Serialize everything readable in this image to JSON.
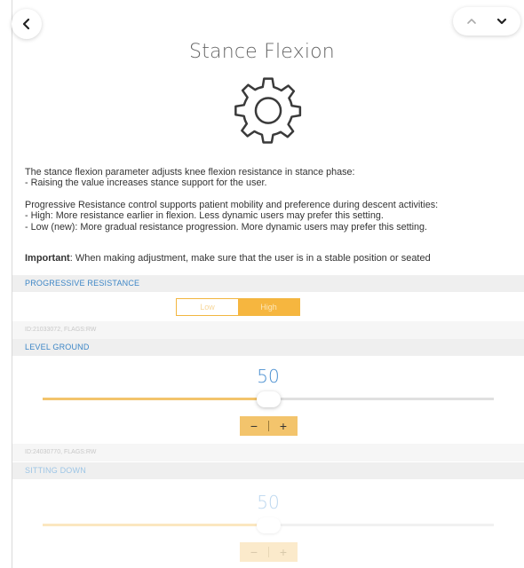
{
  "header": {
    "title": "Stance Flexion",
    "back_icon": "chevron-left-icon",
    "up_icon": "chevron-up-icon",
    "down_icon": "chevron-down-icon"
  },
  "description": {
    "line1": "The stance flexion parameter adjusts knee flexion resistance in stance phase:",
    "line2": " - Raising the value increases stance support for the user.",
    "line3": "Progressive Resistance control supports patient mobility and preference during descent activities:",
    "line4": "- High: More resistance earlier in flexion. Less dynamic users may prefer this setting.",
    "line5": "- Low (new): More gradual resistance progression. More dynamic users may prefer this setting.",
    "important_label": "Important",
    "important_text": ": When making adjustment, make sure that the user is in a stable position or seated"
  },
  "progressive_resistance": {
    "header": "PROGRESSIVE RESISTANCE",
    "options": [
      "Low",
      "High"
    ],
    "selected": "High",
    "id_text": "ID:21033072, FLAGS:RW"
  },
  "level_ground": {
    "header": "LEVEL GROUND",
    "value": "50",
    "fraction": 0.5,
    "minus": "−",
    "plus": "+",
    "id_text": "ID:24030770, FLAGS:RW"
  },
  "sitting_down": {
    "header": "SITTING DOWN",
    "value": "50",
    "fraction": 0.5,
    "minus": "−",
    "plus": "+"
  },
  "colors": {
    "accent_orange": "#f6b63f",
    "accent_blue": "#3d86c6"
  }
}
